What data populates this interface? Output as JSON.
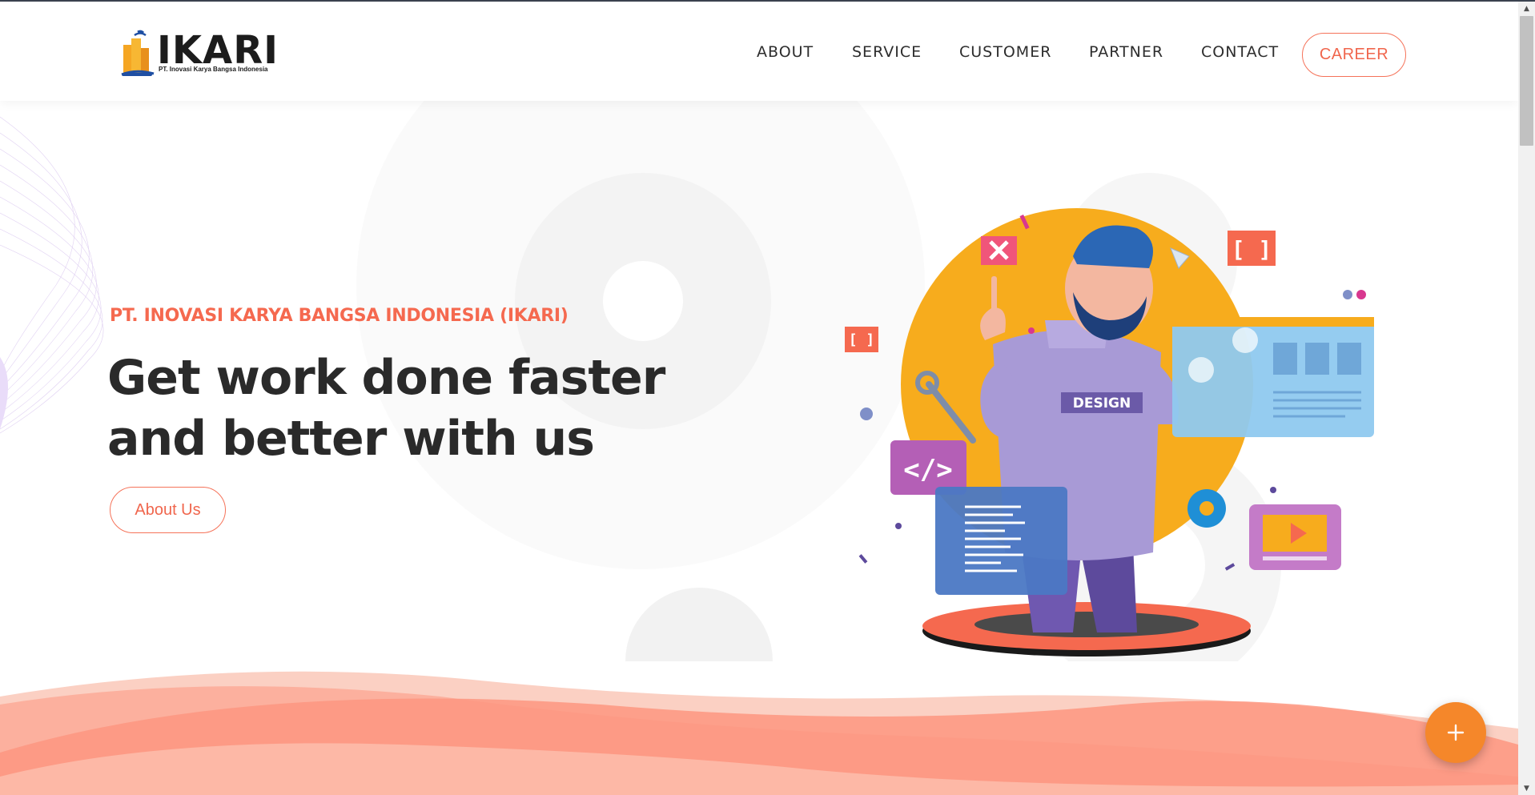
{
  "brand": {
    "name": "IKARI",
    "tagline": "PT. Inovasi Karya Bangsa Indonesia",
    "accent": "#f5694f",
    "logo_orange": "#f5a623",
    "logo_blue": "#1f4fa3"
  },
  "nav": {
    "items": [
      {
        "label": "ABOUT"
      },
      {
        "label": "SERVICE"
      },
      {
        "label": "CUSTOMER"
      },
      {
        "label": "PARTNER"
      },
      {
        "label": "CONTACT"
      }
    ],
    "career_label": "CAREER"
  },
  "hero": {
    "eyebrow": "PT. INOVASI KARYA BANGSA INDONESIA (IKARI)",
    "headline_line1": "Get work done faster",
    "headline_line2": "and better with us",
    "cta_label": "About Us",
    "shirt_text": "DESIGN",
    "code_tag": "</>"
  },
  "fab": {
    "icon": "plus-icon",
    "color": "#f5872a"
  },
  "scrollbar": {
    "up_icon": "arrow-up-icon",
    "down_icon": "arrow-down-icon"
  }
}
